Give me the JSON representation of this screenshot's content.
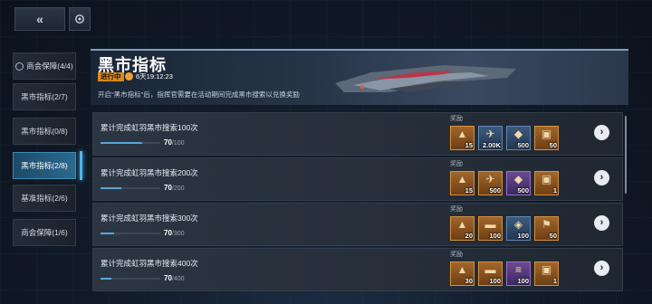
{
  "page": {
    "title": "黑市指标",
    "status": "进行中",
    "countdown": "6天19:12:23",
    "description": "开启\"黑市指标\"后，指挥官需要在活动期间完成黑市搜索以兑换奖励",
    "reward_label": "奖励"
  },
  "sidebar": {
    "items": [
      {
        "label": "商会保障(4/4)",
        "active": false,
        "done": true
      },
      {
        "label": "黑市指标(2/7)",
        "active": false
      },
      {
        "label": "黑市指标(0/8)",
        "active": false
      },
      {
        "label": "黑市指标(2/8)",
        "active": true
      },
      {
        "label": "基准指标(2/6)",
        "active": false
      },
      {
        "label": "商会保障(1/6)",
        "active": false
      }
    ]
  },
  "tasks": [
    {
      "title": "累计完成虹羽黑市搜索100次",
      "current": "70",
      "total": "/100",
      "fraction": 0.7,
      "rewards": [
        {
          "icon": "blueprint-icon",
          "qty": "15",
          "tier": "gold"
        },
        {
          "icon": "aircraft-icon",
          "qty": "2.00K",
          "tier": "blue"
        },
        {
          "icon": "crystal-icon",
          "qty": "500",
          "tier": "blue"
        },
        {
          "icon": "crate-icon",
          "qty": "50",
          "tier": "gold"
        }
      ]
    },
    {
      "title": "累计完成虹羽黑市搜索200次",
      "current": "70",
      "total": "/200",
      "fraction": 0.35,
      "rewards": [
        {
          "icon": "blueprint-icon",
          "qty": "15",
          "tier": "gold"
        },
        {
          "icon": "aircraft-icon",
          "qty": "500",
          "tier": "gold"
        },
        {
          "icon": "crystal-icon",
          "qty": "500",
          "tier": "purple"
        },
        {
          "icon": "crate-icon",
          "qty": "1",
          "tier": "gold"
        }
      ]
    },
    {
      "title": "累计完成虹羽黑市搜索300次",
      "current": "70",
      "total": "/300",
      "fraction": 0.233,
      "rewards": [
        {
          "icon": "blueprint-icon",
          "qty": "20",
          "tier": "gold"
        },
        {
          "icon": "chest-icon",
          "qty": "100",
          "tier": "gold"
        },
        {
          "icon": "gem-icon",
          "qty": "100",
          "tier": "blue"
        },
        {
          "icon": "flag-icon",
          "qty": "50",
          "tier": "gold"
        }
      ]
    },
    {
      "title": "累计完成虹羽黑市搜索400次",
      "current": "70",
      "total": "/400",
      "fraction": 0.175,
      "rewards": [
        {
          "icon": "blueprint-icon",
          "qty": "30",
          "tier": "gold"
        },
        {
          "icon": "chest-icon",
          "qty": "100",
          "tier": "gold"
        },
        {
          "icon": "ammo-icon",
          "qty": "100",
          "tier": "purple"
        },
        {
          "icon": "crate-icon",
          "qty": "1",
          "tier": "gold"
        }
      ]
    }
  ],
  "icons": {
    "back": "double-chevron-left-icon",
    "refresh": "refresh-icon",
    "go": "chevron-right-icon",
    "timer": "clock-icon"
  },
  "colors": {
    "accent": "#4fb6ea",
    "status": "#d88a1e",
    "progress": "#5aa6d6",
    "gold_tier": "#d59040",
    "purple_tier": "#9a70d0",
    "blue_tier": "#5f86b6"
  }
}
